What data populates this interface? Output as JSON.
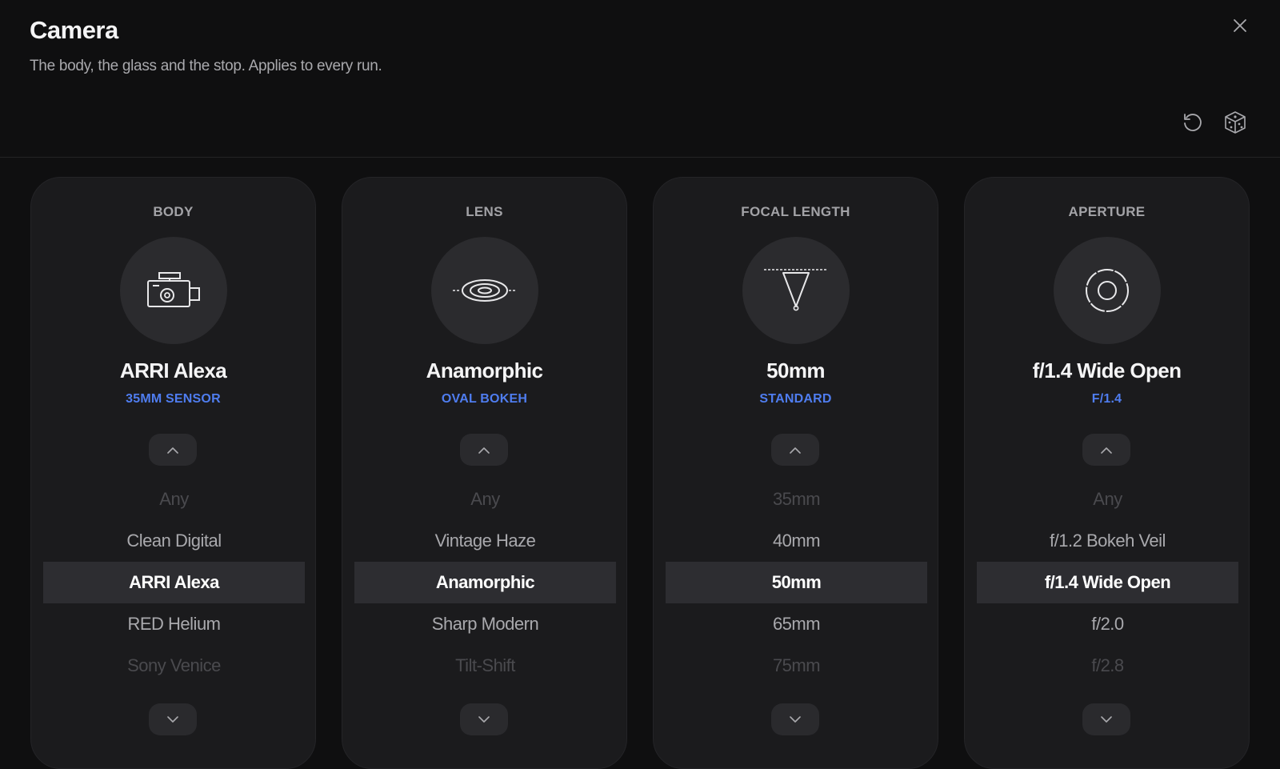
{
  "header": {
    "title": "Camera",
    "subtitle": "The body, the glass and the stop. Applies to every run.",
    "close_icon": "close-icon",
    "reset_icon": "reset-icon",
    "random_icon": "dice-icon"
  },
  "colors": {
    "background": "#0f0f10",
    "card": "#1b1b1d",
    "accent": "#4f7df0",
    "selected_row": "#2d2d31"
  },
  "cards": [
    {
      "label": "BODY",
      "icon": "camera-body-icon",
      "value": "ARRI Alexa",
      "sub": "35MM SENSOR",
      "options": [
        "Any",
        "Clean Digital",
        "ARRI Alexa",
        "RED Helium",
        "Sony Venice"
      ]
    },
    {
      "label": "LENS",
      "icon": "lens-icon",
      "value": "Anamorphic",
      "sub": "OVAL BOKEH",
      "options": [
        "Any",
        "Vintage Haze",
        "Anamorphic",
        "Sharp Modern",
        "Tilt-Shift"
      ]
    },
    {
      "label": "FOCAL LENGTH",
      "icon": "focal-length-icon",
      "value": "50mm",
      "sub": "STANDARD",
      "options": [
        "35mm",
        "40mm",
        "50mm",
        "65mm",
        "75mm"
      ]
    },
    {
      "label": "APERTURE",
      "icon": "aperture-icon",
      "value": "f/1.4 Wide Open",
      "sub": "F/1.4",
      "options": [
        "Any",
        "f/1.2 Bokeh Veil",
        "f/1.4 Wide Open",
        "f/2.0",
        "f/2.8"
      ]
    }
  ]
}
